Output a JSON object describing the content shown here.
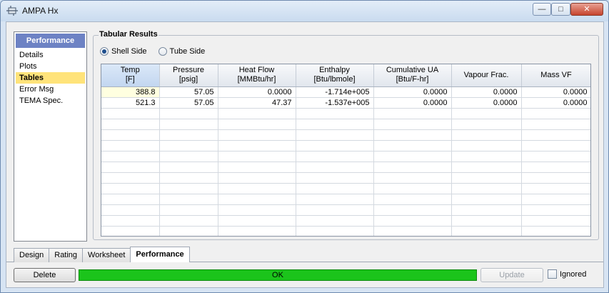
{
  "window": {
    "title": "AMPA Hx",
    "minimize": "—",
    "maximize": "□",
    "close": "✕"
  },
  "nav": {
    "header": "Performance",
    "items": [
      "Details",
      "Plots",
      "Tables",
      "Error Msg",
      "TEMA Spec."
    ],
    "selected": "Tables"
  },
  "results": {
    "group_title": "Tabular Results",
    "radios": {
      "shell": "Shell Side",
      "tube": "Tube Side",
      "selected": "shell"
    },
    "columns": [
      {
        "name": "Temp",
        "unit": "[F]"
      },
      {
        "name": "Pressure",
        "unit": "[psig]"
      },
      {
        "name": "Heat Flow",
        "unit": "[MMBtu/hr]"
      },
      {
        "name": "Enthalpy",
        "unit": "[Btu/lbmole]"
      },
      {
        "name": "Cumulative UA",
        "unit": "[Btu/F-hr]"
      },
      {
        "name": "Vapour Frac.",
        "unit": ""
      },
      {
        "name": "Mass VF",
        "unit": ""
      }
    ],
    "rows": [
      [
        "388.8",
        "57.05",
        "0.0000",
        "-1.714e+005",
        "0.0000",
        "0.0000",
        "0.0000"
      ],
      [
        "521.3",
        "57.05",
        "47.37",
        "-1.537e+005",
        "0.0000",
        "0.0000",
        "0.0000"
      ]
    ]
  },
  "tabs": [
    "Design",
    "Rating",
    "Worksheet",
    "Performance"
  ],
  "active_tab": "Performance",
  "footer": {
    "delete": "Delete",
    "status": "OK",
    "update": "Update",
    "ignored": "Ignored"
  },
  "colors": {
    "status_ok": "#1bc41b",
    "nav_header": "#6d82c4",
    "selection": "#ffe37a"
  }
}
